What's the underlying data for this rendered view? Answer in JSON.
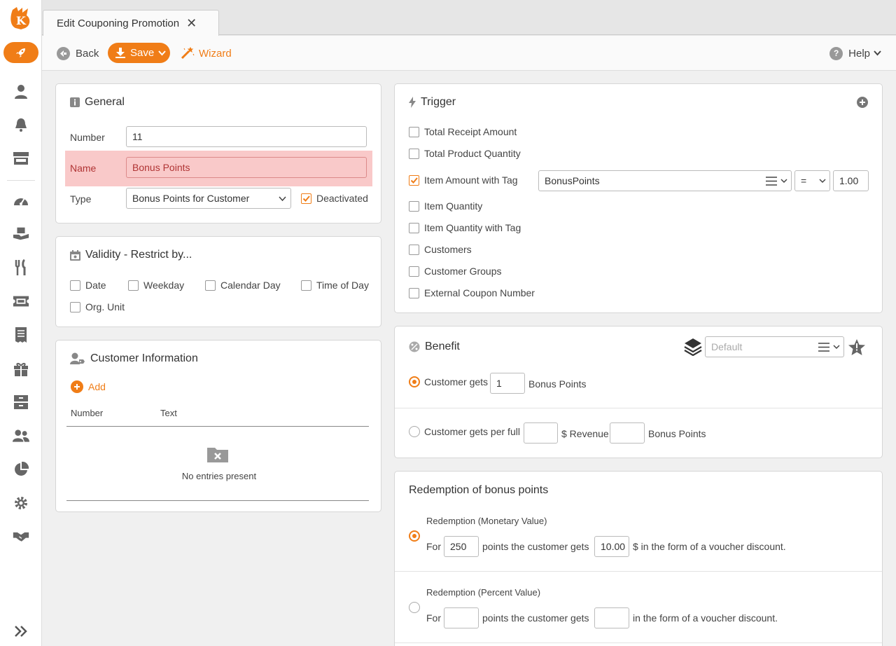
{
  "tab": {
    "title": "Edit Couponing Promotion"
  },
  "toolbar": {
    "back": "Back",
    "save": "Save",
    "wizard": "Wizard",
    "help": "Help"
  },
  "general": {
    "title": "General",
    "number_label": "Number",
    "number_value": "11",
    "name_label": "Name",
    "name_value": "Bonus Points",
    "type_label": "Type",
    "type_value": "Bonus Points for Customer",
    "deactivated_label": "Deactivated",
    "deactivated_checked": true
  },
  "validity": {
    "title": "Validity - Restrict by...",
    "options": [
      "Date",
      "Weekday",
      "Calendar Day",
      "Time of Day",
      "Org. Unit"
    ]
  },
  "customer_info": {
    "title": "Customer Information",
    "add": "Add",
    "columns": [
      "Number",
      "Text"
    ],
    "empty": "No entries present"
  },
  "trigger": {
    "title": "Trigger",
    "options": [
      {
        "label": "Total Receipt Amount",
        "checked": false
      },
      {
        "label": "Total Product Quantity",
        "checked": false
      },
      {
        "label": "Item Amount with Tag",
        "checked": true
      },
      {
        "label": "Item Quantity",
        "checked": false
      },
      {
        "label": "Item Quantity with Tag",
        "checked": false
      },
      {
        "label": "Customers",
        "checked": false
      },
      {
        "label": "Customer Groups",
        "checked": false
      },
      {
        "label": "External Coupon Number",
        "checked": false
      }
    ],
    "tag_value": "BonusPoints",
    "operator": "=",
    "amount": "1.00"
  },
  "benefit": {
    "title": "Benefit",
    "default_placeholder": "Default",
    "option1_prefix": "Customer gets",
    "option1_value": "1",
    "option1_suffix": "Bonus Points",
    "option2_prefix": "Customer gets per full",
    "option2_mid": "$ Revenue",
    "option2_suffix": "Bonus Points"
  },
  "redemption": {
    "title": "Redemption of bonus points",
    "monetary_title": "Redemption (Monetary Value)",
    "monetary_for": "For",
    "monetary_points": "250",
    "monetary_mid": "points  the customer gets",
    "monetary_value": "10.00",
    "monetary_suffix": "$  in the form of a voucher discount.",
    "percent_title": "Redemption (Percent Value)",
    "percent_for": "For",
    "percent_mid": "points  the customer gets",
    "percent_suffix": "in the form of a voucher discount."
  },
  "colors": {
    "accent": "#f07d17",
    "error_bg": "#f9c9c9"
  }
}
